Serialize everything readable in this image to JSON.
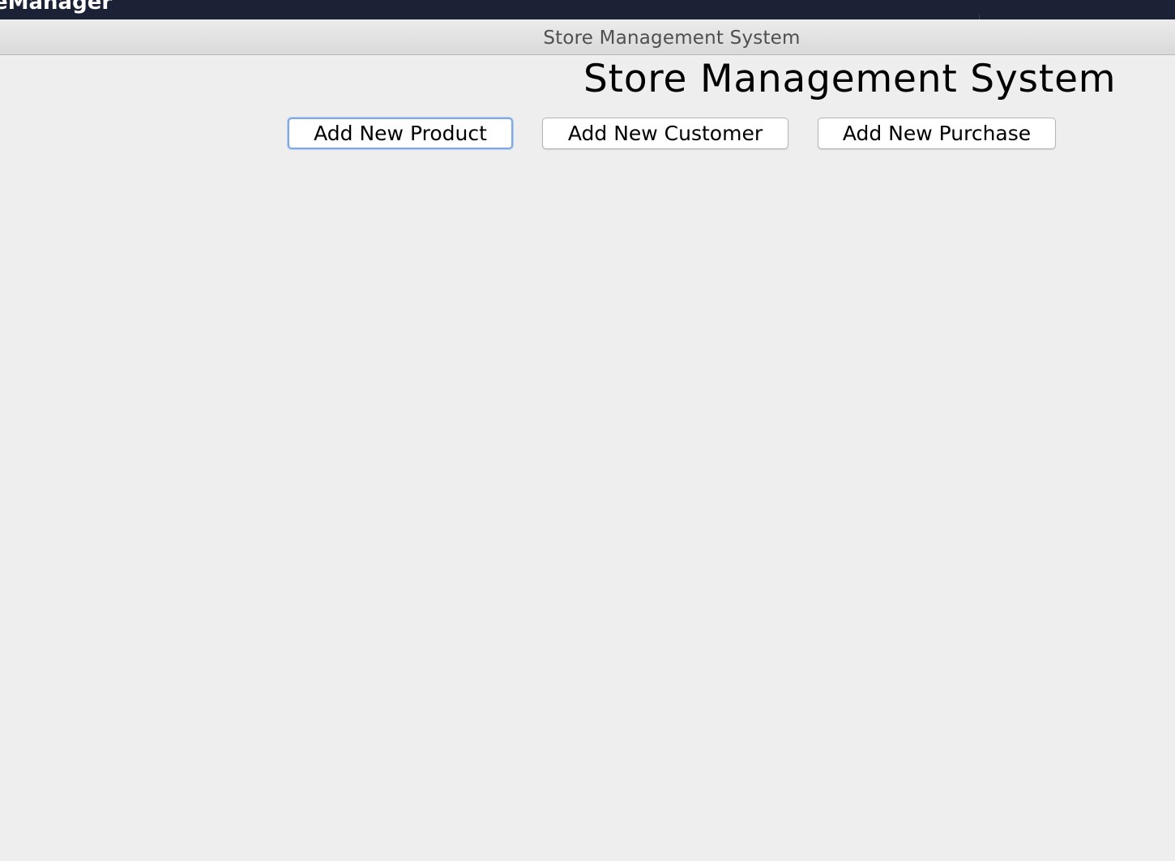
{
  "menubar": {
    "app_name": "eManager"
  },
  "window": {
    "title": "Store Management System"
  },
  "main": {
    "heading": "Store Management System",
    "buttons": {
      "add_product": "Add New Product",
      "add_customer": "Add New Customer",
      "add_purchase": "Add New Purchase"
    }
  },
  "colors": {
    "menubar_bg": "#1b2236",
    "window_bg": "#eeeeee",
    "focus_ring": "#7ea9e2"
  }
}
